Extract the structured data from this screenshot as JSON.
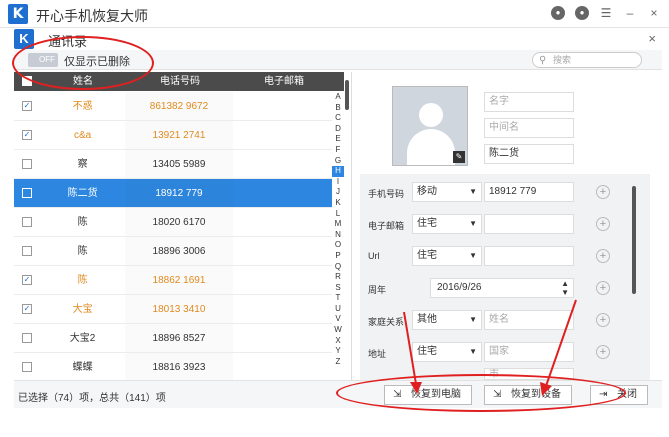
{
  "app": {
    "title": "开心手机恢复大师",
    "logo_letter": "K"
  },
  "window_controls": {
    "icons": [
      "wechat-icon",
      "chat-bubble-icon",
      "menu-icon"
    ],
    "minimize": "–",
    "close": "×"
  },
  "panel": {
    "title": "通讯录",
    "close": "×"
  },
  "toolbar": {
    "toggle_state": "OFF",
    "toggle_label": "仅显示已删除",
    "search_placeholder": "搜索"
  },
  "table": {
    "headers": {
      "name": "姓名",
      "phone": "电话号码",
      "email": "电子邮箱"
    },
    "rows": [
      {
        "name": "不惑",
        "phone": "861382    9672",
        "checked": true,
        "selected": false
      },
      {
        "name": "c&a",
        "phone": "13921    2741",
        "checked": true,
        "selected": false
      },
      {
        "name": "察",
        "phone": "13405    5989",
        "checked": false,
        "selected": false
      },
      {
        "name": "陈二货",
        "phone": "18912    779",
        "checked": false,
        "selected": true
      },
      {
        "name": "陈",
        "phone": "18020    6170",
        "checked": false,
        "selected": false
      },
      {
        "name": "陈",
        "phone": "18896    3006",
        "checked": false,
        "selected": false
      },
      {
        "name": "陈",
        "phone": "18862    1691",
        "checked": true,
        "selected": false
      },
      {
        "name": "大宝",
        "phone": "18013    3410",
        "checked": true,
        "selected": false
      },
      {
        "name": "大宝2",
        "phone": "18896    8527",
        "checked": false,
        "selected": false
      },
      {
        "name": "蝶蝶",
        "phone": "18816    3923",
        "checked": false,
        "selected": false
      }
    ],
    "alphabet": [
      "A",
      "B",
      "C",
      "D",
      "E",
      "F",
      "G",
      "H",
      "I",
      "J",
      "K",
      "L",
      "M",
      "N",
      "O",
      "P",
      "Q",
      "R",
      "S",
      "T",
      "U",
      "V",
      "W",
      "X",
      "Y",
      "Z"
    ],
    "active_letter": "H"
  },
  "detail": {
    "name_fields": [
      {
        "placeholder": "名字",
        "value": ""
      },
      {
        "placeholder": "中间名",
        "value": ""
      },
      {
        "placeholder": "",
        "value": "陈二货"
      }
    ],
    "rows": [
      {
        "label": "手机号码",
        "type": "select",
        "select": "移动",
        "value": "18912    779",
        "placeholder": ""
      },
      {
        "label": "电子邮箱",
        "type": "select",
        "select": "住宅",
        "value": "",
        "placeholder": ""
      },
      {
        "label": "Url",
        "type": "select",
        "select": "住宅",
        "value": "",
        "placeholder": ""
      },
      {
        "label": "周年",
        "type": "date",
        "select": "",
        "value": "2016/9/26",
        "placeholder": ""
      },
      {
        "label": "家庭关系",
        "type": "select",
        "select": "其他",
        "value": "",
        "placeholder": "姓名"
      },
      {
        "label": "地址",
        "type": "select",
        "select": "住宅",
        "value": "",
        "placeholder": "国家"
      }
    ],
    "address_extra": {
      "placeholder": "市"
    }
  },
  "footer": {
    "status": "已选择（74）项，总共（141）项",
    "buttons": {
      "restore_pc": "恢复到电脑",
      "restore_device": "恢复到设备",
      "close": "关闭"
    }
  },
  "colors": {
    "accent": "#2d87e0",
    "checked_text": "#e08a1e",
    "annotation": "#e02020"
  }
}
